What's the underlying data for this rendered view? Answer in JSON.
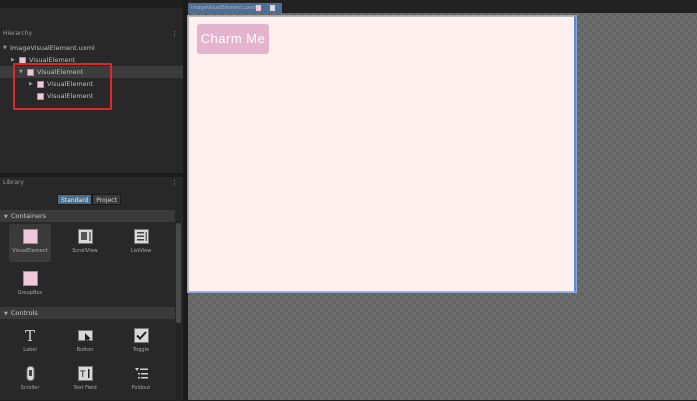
{
  "hierarchy": {
    "title": "Hierarchy",
    "menu_glyph": "⋮",
    "root": "ImageVisualElement.uxml",
    "items": [
      {
        "label": "VisualElement"
      },
      {
        "label": "VisualElement"
      },
      {
        "label": "VisualElement"
      },
      {
        "label": "VisualElement"
      }
    ]
  },
  "library": {
    "title": "Library",
    "menu_glyph": "⋮",
    "tabs": {
      "standard": "Standard",
      "project": "Project"
    },
    "sections": {
      "containers": "Containers",
      "controls": "Controls"
    },
    "containers": [
      {
        "label": "VisualElement",
        "icon": "visual-element-icon"
      },
      {
        "label": "ScrollView",
        "icon": "scroll-view-icon"
      },
      {
        "label": "ListView",
        "icon": "list-view-icon"
      },
      {
        "label": "GroupBox",
        "icon": "group-box-icon"
      }
    ],
    "controls": [
      {
        "label": "Label",
        "icon": "label-icon"
      },
      {
        "label": "Button",
        "icon": "button-icon"
      },
      {
        "label": "Toggle",
        "icon": "toggle-icon"
      },
      {
        "label": "Scroller",
        "icon": "scroller-icon"
      },
      {
        "label": "Text Field",
        "icon": "text-field-icon"
      },
      {
        "label": "Foldout",
        "icon": "foldout-icon"
      }
    ]
  },
  "canvas": {
    "tab_label": "ImageVisualElement.uxml",
    "button_text": "Charm Me",
    "colors": {
      "viewport_bg": "#fff0ef",
      "button_bg": "#e4b3cd",
      "selection_outline": "#e0262b",
      "accent": "#4e6f93"
    }
  }
}
